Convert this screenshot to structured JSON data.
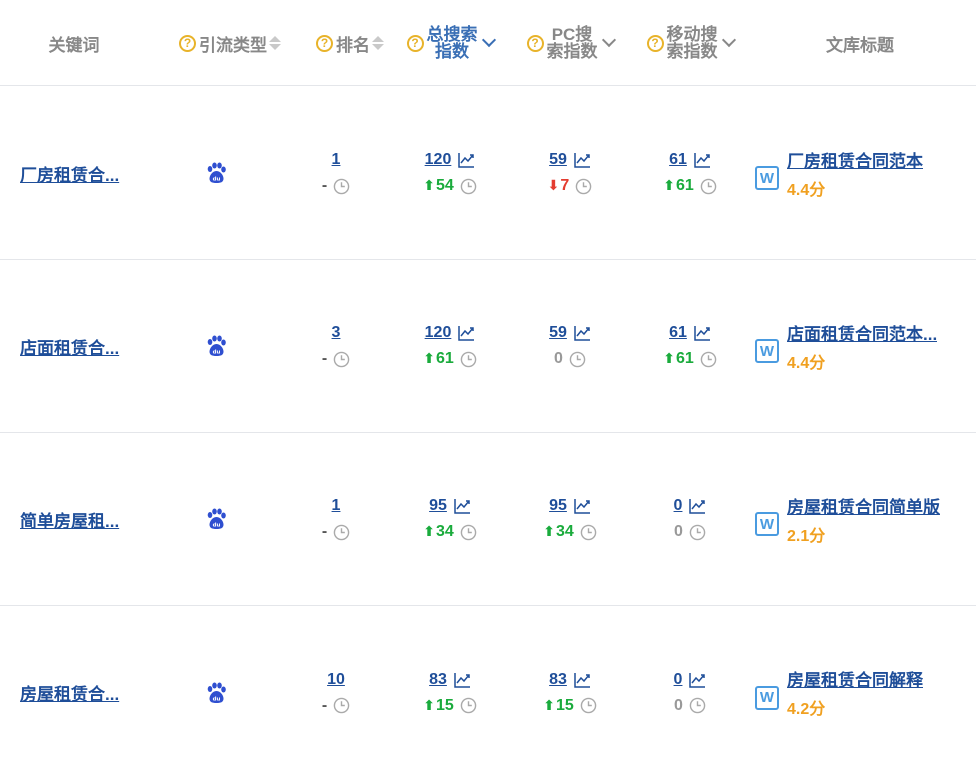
{
  "header": {
    "keyword": "关键词",
    "traffic_type": "引流类型",
    "rank": "排名",
    "total_index_l1": "总搜索",
    "total_index_l2": "指数",
    "pc_index_l1": "PC搜",
    "pc_index_l2": "索指数",
    "mobile_index_l1": "移动搜",
    "mobile_index_l2": "索指数",
    "doc_title": "文库标题",
    "help_glyph": "?"
  },
  "icons": {
    "source": "baidu-paw-icon",
    "trend": "trend-chart-icon",
    "history": "clock-icon",
    "doc": "word-doc-icon"
  },
  "colors": {
    "link": "#1f4e99",
    "up": "#1aab3c",
    "down": "#e43c30",
    "score": "#f0a020",
    "help": "#e8b32a"
  },
  "rows": [
    {
      "keyword": "厂房租赁合...",
      "rank": "1",
      "rank_change": "-",
      "total": "120",
      "total_change": "54",
      "total_dir": "up",
      "pc": "59",
      "pc_change": "7",
      "pc_dir": "down",
      "mobile": "61",
      "mobile_change": "61",
      "mobile_dir": "up",
      "doc_badge": "W",
      "doc_title": "厂房租赁合同范本",
      "score": "4.4分"
    },
    {
      "keyword": "店面租赁合...",
      "rank": "3",
      "rank_change": "-",
      "total": "120",
      "total_change": "61",
      "total_dir": "up",
      "pc": "59",
      "pc_change": "0",
      "pc_dir": "zero",
      "mobile": "61",
      "mobile_change": "61",
      "mobile_dir": "up",
      "doc_badge": "W",
      "doc_title": "店面租赁合同范本...",
      "score": "4.4分"
    },
    {
      "keyword": "简单房屋租...",
      "rank": "1",
      "rank_change": "-",
      "total": "95",
      "total_change": "34",
      "total_dir": "up",
      "pc": "95",
      "pc_change": "34",
      "pc_dir": "up",
      "mobile": "0",
      "mobile_change": "0",
      "mobile_dir": "zero",
      "doc_badge": "W",
      "doc_title": "房屋租赁合同简单版",
      "score": "2.1分"
    },
    {
      "keyword": "房屋租赁合...",
      "rank": "10",
      "rank_change": "-",
      "total": "83",
      "total_change": "15",
      "total_dir": "up",
      "pc": "83",
      "pc_change": "15",
      "pc_dir": "up",
      "mobile": "0",
      "mobile_change": "0",
      "mobile_dir": "zero",
      "doc_badge": "W",
      "doc_title": "房屋租赁合同解释",
      "score": "4.2分"
    }
  ]
}
